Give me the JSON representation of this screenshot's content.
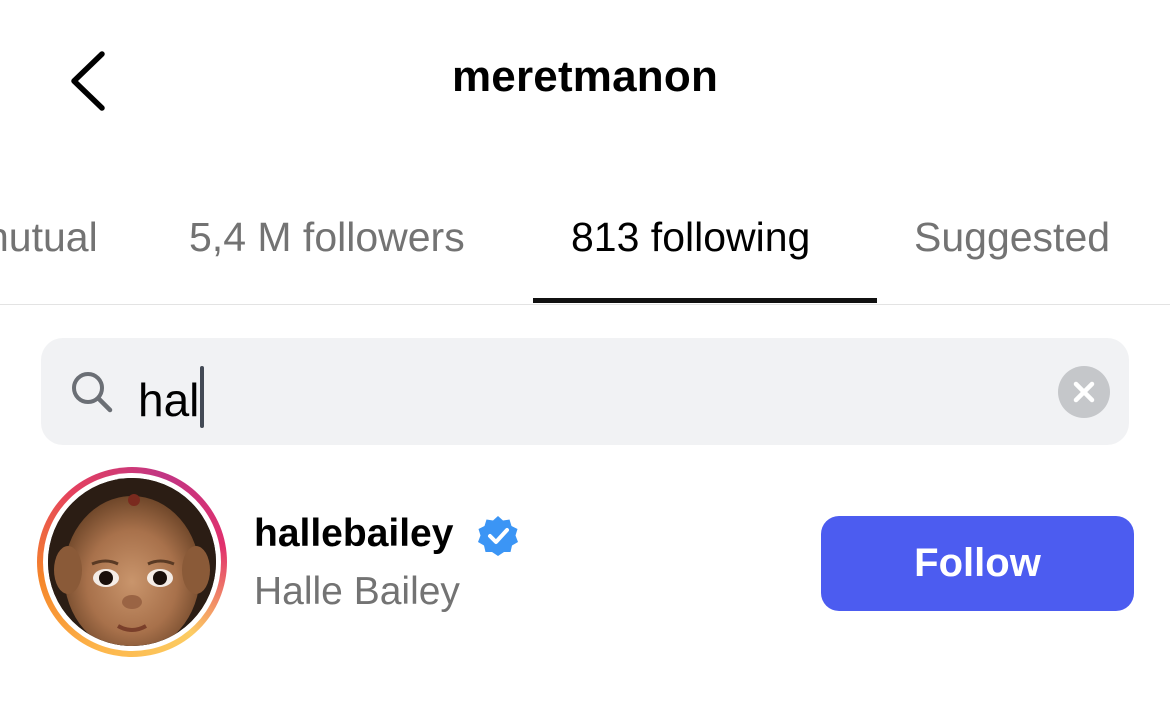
{
  "header": {
    "title": "meretmanon",
    "back_icon": "chevron-left-icon"
  },
  "tabs": [
    {
      "label": "nutual",
      "active": false
    },
    {
      "label": "5,4 M followers",
      "active": false
    },
    {
      "label": "813 following",
      "active": true
    },
    {
      "label": "Suggested",
      "active": false
    }
  ],
  "search": {
    "value": "hal",
    "icon": "search-icon",
    "clear_icon": "clear-icon"
  },
  "results": [
    {
      "username": "hallebailey",
      "full_name": "Halle Bailey",
      "verified": true,
      "button_label": "Follow"
    }
  ],
  "colors": {
    "accent": "#4c5cf0",
    "verified": "#3b95f5",
    "muted_text": "#737373",
    "search_bg": "#f1f2f4"
  }
}
